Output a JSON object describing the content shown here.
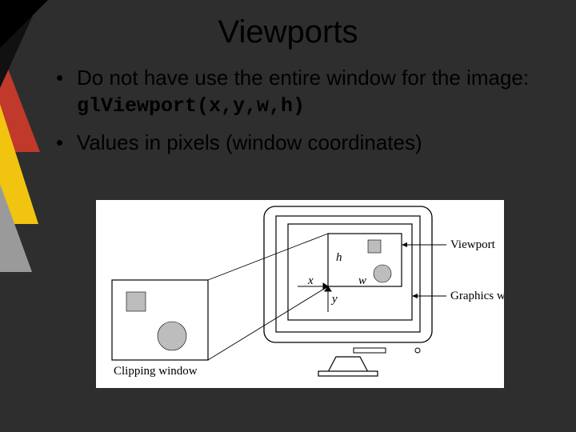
{
  "title": "Viewports",
  "bullets": [
    {
      "prefix": "Do not have use the entire window for the image: ",
      "code": "glViewport(x,y,w,h)"
    },
    {
      "prefix": "Values in pixels (window coordinates)",
      "code": ""
    }
  ],
  "figure": {
    "clipping_label": "Clipping window",
    "viewport_label": "Viewport",
    "graphics_label": "Graphics window",
    "h": "h",
    "w": "w",
    "x": "x",
    "y": "y"
  }
}
